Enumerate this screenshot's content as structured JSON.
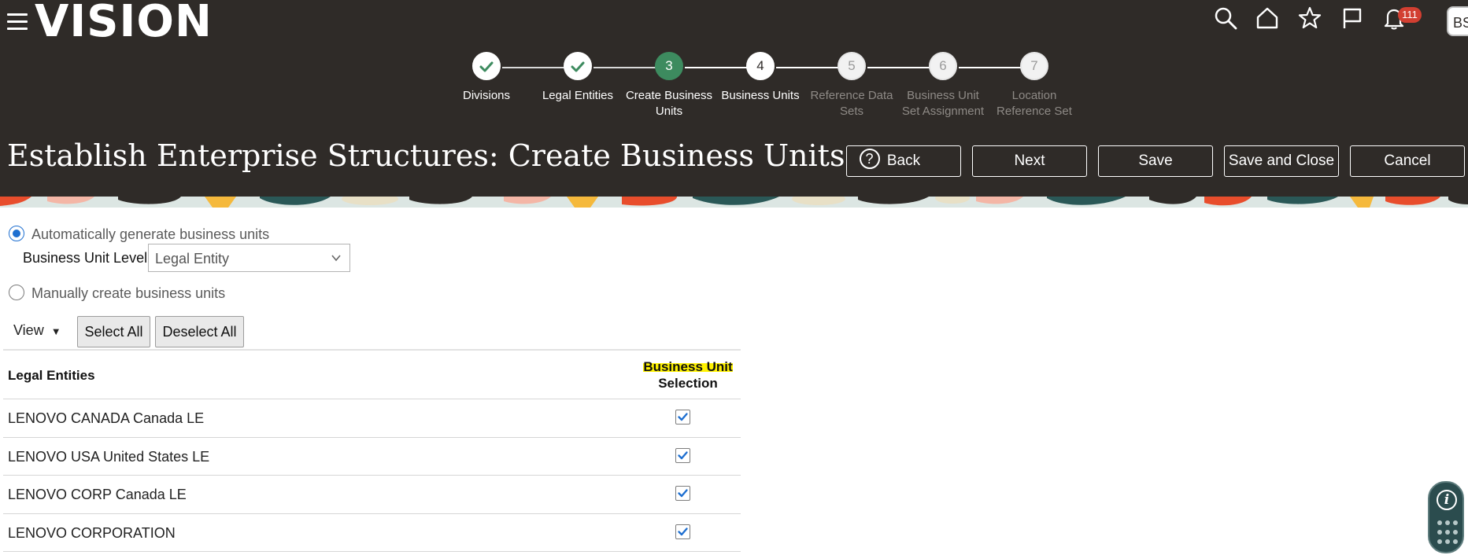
{
  "app": {
    "logo": "VISION"
  },
  "header": {
    "notifications_count": "111",
    "user_initials": "BS",
    "page_title": "Establish Enterprise Structures: Create Business Units",
    "help_glyph": "?"
  },
  "train": {
    "stops": [
      {
        "label": "Divisions",
        "state": "done"
      },
      {
        "label": "Legal Entities",
        "state": "done"
      },
      {
        "number": "3",
        "label": "Create Business Units",
        "state": "current"
      },
      {
        "number": "4",
        "label": "Business Units",
        "state": "next"
      },
      {
        "number": "5",
        "label": "Reference Data Sets",
        "state": "future"
      },
      {
        "number": "6",
        "label": "Business Unit Set Assignment",
        "state": "future"
      },
      {
        "number": "7",
        "label": "Location Reference Set",
        "state": "future"
      }
    ]
  },
  "actions": {
    "back": "Back",
    "next": "Next",
    "save": "Save",
    "save_close": "Save and Close",
    "cancel": "Cancel"
  },
  "options": {
    "auto_label": "Automatically generate business units",
    "bu_level_label": "Business Unit Level",
    "bu_level_value": "Legal Entity",
    "manual_label": "Manually create business units"
  },
  "toolbar": {
    "view": "View",
    "select_all": "Select All",
    "deselect_all": "Deselect All"
  },
  "table": {
    "col_entities": "Legal Entities",
    "col_selection_line1": "Business Unit",
    "col_selection_line2": "Selection",
    "rows": [
      {
        "name": "LENOVO CANADA Canada LE",
        "checked": true
      },
      {
        "name": "LENOVO USA United States LE",
        "checked": true
      },
      {
        "name": "LENOVO CORP Canada LE",
        "checked": true
      },
      {
        "name": "LENOVO CORPORATION",
        "checked": true
      }
    ]
  },
  "colors": {
    "header_bg": "#2f2b28",
    "current_step": "#3d8b5f",
    "accent_blue": "#1e6fd0",
    "badge_red": "#d23f31",
    "highlight": "#fff200"
  }
}
